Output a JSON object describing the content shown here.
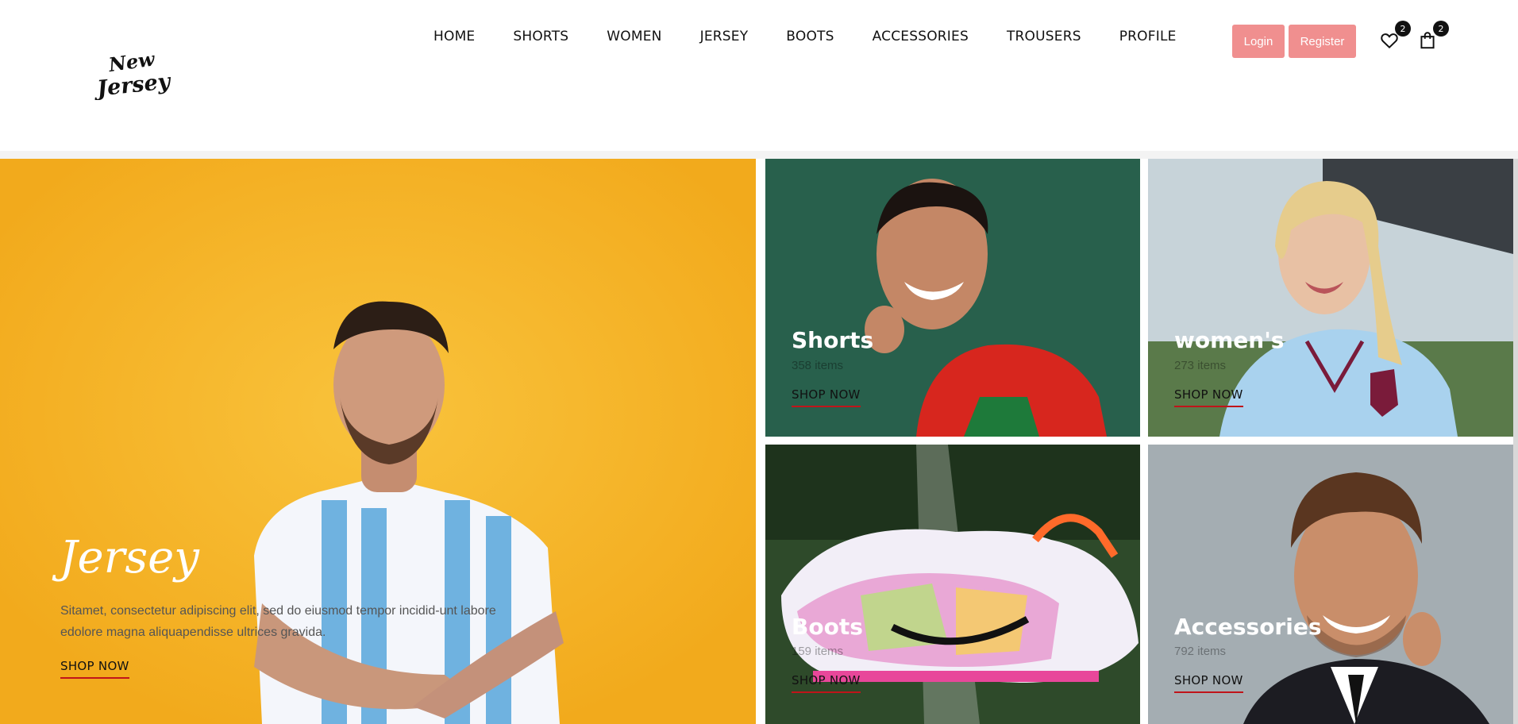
{
  "brand": {
    "logo_text": "New Jersey"
  },
  "nav": {
    "items": [
      "HOME",
      "SHORTS",
      "WOMEN",
      "JERSEY",
      "BOOTS",
      "ACCESSORIES",
      "TROUSERS",
      "PROFILE"
    ]
  },
  "auth": {
    "login_label": "Login",
    "register_label": "Register"
  },
  "header_icons": {
    "wishlist_count": "2",
    "cart_count": "2"
  },
  "colors": {
    "accent": "#f08f8f",
    "underline": "#c0141a",
    "hero_bg": "#f5b62a"
  },
  "hero": {
    "title": "Jersey",
    "text": "Sitamet, consectetur adipiscing elit, sed do eiusmod tempor incidid-unt labore edolore magna aliquapendisse ultrices gravida.",
    "cta": "SHOP NOW"
  },
  "categories": [
    {
      "title": "Shorts",
      "count": "358 items",
      "cta": "SHOP NOW"
    },
    {
      "title": "women's",
      "count": "273 items",
      "cta": "SHOP NOW"
    },
    {
      "title": "Boots",
      "count": "159 items",
      "cta": "SHOP NOW"
    },
    {
      "title": "Accessories",
      "count": "792 items",
      "cta": "SHOP NOW"
    }
  ]
}
